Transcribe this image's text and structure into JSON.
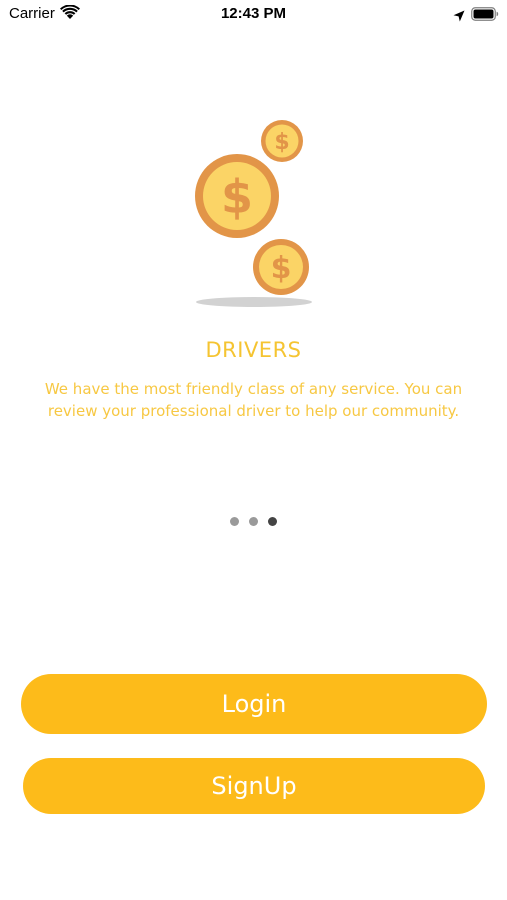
{
  "status_bar": {
    "carrier": "Carrier",
    "time": "12:43 PM"
  },
  "onboarding": {
    "title": "DRIVERS",
    "description": "We have the most friendly class of any service. You can review your professional driver to help our community.",
    "illustration_icon": "coins-icon",
    "page_count": 3,
    "active_page_index": 2
  },
  "actions": {
    "login_label": "Login",
    "signup_label": "SignUp"
  },
  "colors": {
    "accent": "#FDBB1A",
    "title_text": "#F5C431",
    "coin_fill": "#FBD466",
    "coin_rim": "#E29548",
    "dot_inactive": "#9A9A9A",
    "dot_active": "#444444"
  }
}
